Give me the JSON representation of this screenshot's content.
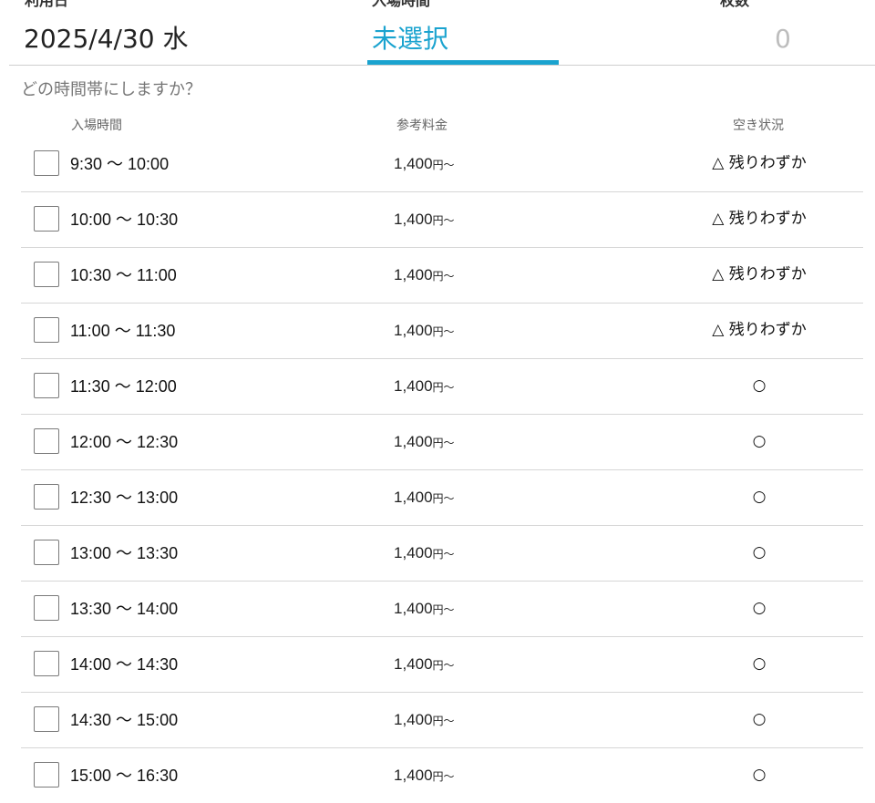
{
  "summary": {
    "date_label": "利用日",
    "date_value": "2025/4/30 水",
    "time_label": "入場時間",
    "time_value": "未選択",
    "count_label": "枚数",
    "count_value": "0"
  },
  "question": "どの時間帯にしますか？",
  "columns": {
    "time": "入場時間",
    "price": "参考料金",
    "status": "空き状況"
  },
  "colors": {
    "accent": "#1aa3cf",
    "count_inactive": "#bdbdbd"
  },
  "slots": [
    {
      "time": "9:30 〜 10:00",
      "price": "1,400",
      "unit": "円〜",
      "status": "△ 残りわずか"
    },
    {
      "time": "10:00 〜 10:30",
      "price": "1,400",
      "unit": "円〜",
      "status": "△ 残りわずか"
    },
    {
      "time": "10:30 〜 11:00",
      "price": "1,400",
      "unit": "円〜",
      "status": "△ 残りわずか"
    },
    {
      "time": "11:00 〜 11:30",
      "price": "1,400",
      "unit": "円〜",
      "status": "△ 残りわずか"
    },
    {
      "time": "11:30 〜 12:00",
      "price": "1,400",
      "unit": "円〜",
      "status": "○"
    },
    {
      "time": "12:00 〜 12:30",
      "price": "1,400",
      "unit": "円〜",
      "status": "○"
    },
    {
      "time": "12:30 〜 13:00",
      "price": "1,400",
      "unit": "円〜",
      "status": "○"
    },
    {
      "time": "13:00 〜 13:30",
      "price": "1,400",
      "unit": "円〜",
      "status": "○"
    },
    {
      "time": "13:30 〜 14:00",
      "price": "1,400",
      "unit": "円〜",
      "status": "○"
    },
    {
      "time": "14:00 〜 14:30",
      "price": "1,400",
      "unit": "円〜",
      "status": "○"
    },
    {
      "time": "14:30 〜 15:00",
      "price": "1,400",
      "unit": "円〜",
      "status": "○"
    },
    {
      "time": "15:00 〜 16:30",
      "price": "1,400",
      "unit": "円〜",
      "status": "○"
    }
  ]
}
